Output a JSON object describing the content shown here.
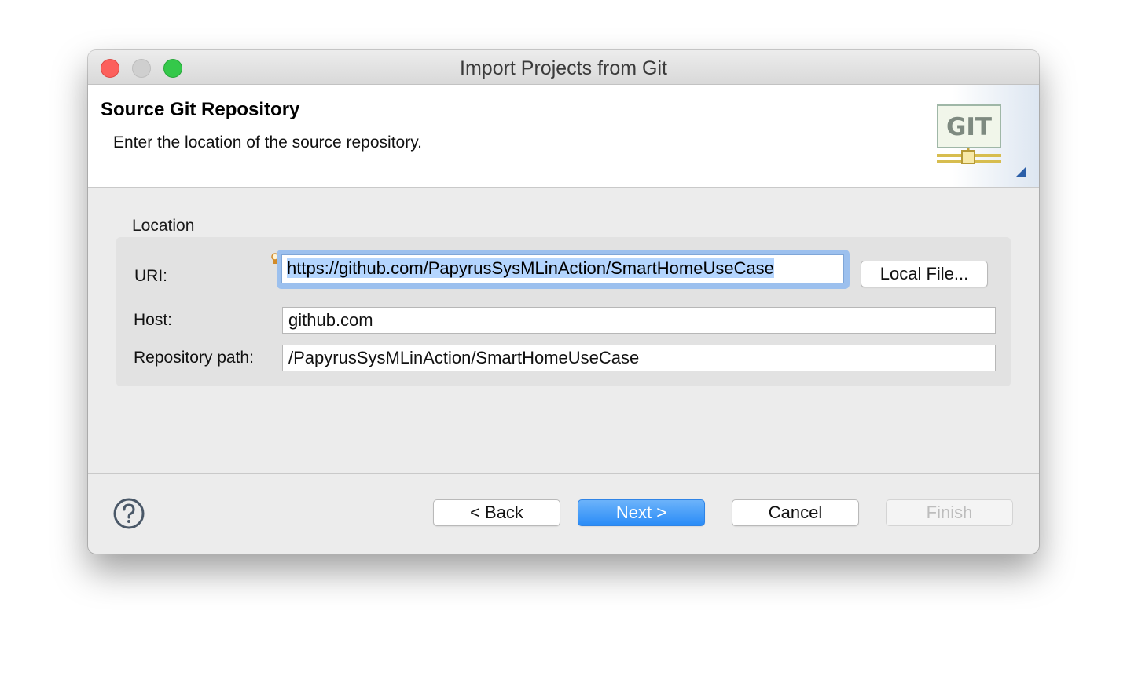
{
  "window": {
    "title": "Import Projects from Git"
  },
  "banner": {
    "heading": "Source Git Repository",
    "description": "Enter the location of the source repository.",
    "image_text": "GIT",
    "image_icon": "git-wizard-banner-icon"
  },
  "location": {
    "group_label": "Location",
    "uri_label": "URI:",
    "uri_value": "https://github.com/PapyrusSysMLinAction/SmartHomeUseCase",
    "local_file_button": "Local File...",
    "host_label": "Host:",
    "host_value": "github.com",
    "repo_path_label": "Repository path:",
    "repo_path_value": "/PapyrusSysMLinAction/SmartHomeUseCase"
  },
  "buttons": {
    "back": "< Back",
    "next": "Next >",
    "cancel": "Cancel",
    "finish": "Finish",
    "finish_enabled": false
  },
  "icons": {
    "help": "help-icon",
    "content_assist": "lightbulb-icon"
  },
  "colors": {
    "accent": "#2a8cf7",
    "focus_ring": "#9cc0ee",
    "selection": "#b4d5fe",
    "close": "#fc605c",
    "zoom": "#34c84a"
  }
}
